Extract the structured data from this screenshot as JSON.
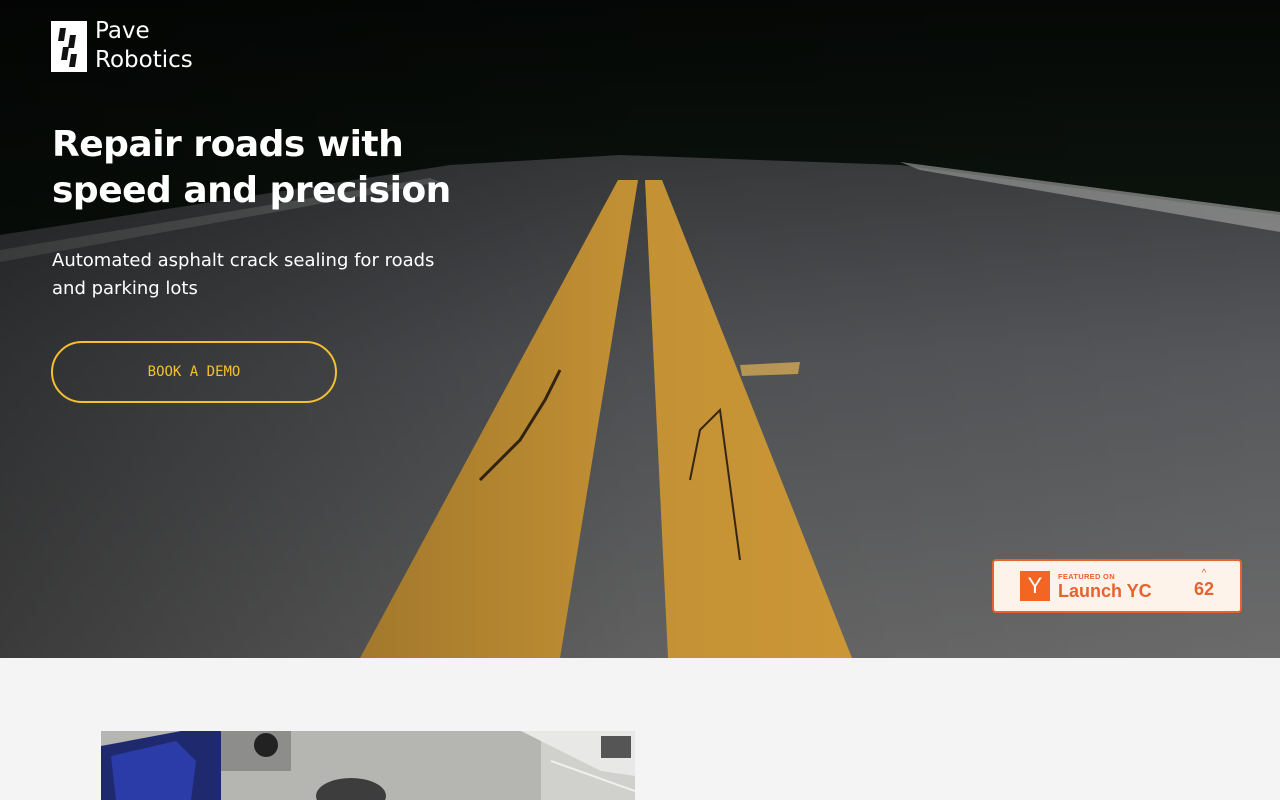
{
  "brand": {
    "name_line1": "Pave",
    "name_line2": "Robotics",
    "logo_icon": "pave-logo-icon"
  },
  "hero": {
    "headline": "Repair roads with speed and precision",
    "subtitle": "Automated asphalt crack sealing for roads and parking lots",
    "cta_label": "BOOK A DEMO"
  },
  "yc_badge": {
    "featured": "FEATURED ON",
    "launch": "Launch YC",
    "logo_letter": "Y",
    "upvote_icon": "caret-up-icon",
    "votes": "62"
  },
  "colors": {
    "accent": "#f5c02e",
    "yc_orange": "#e8622f",
    "page_bg": "#f4f4f4"
  }
}
